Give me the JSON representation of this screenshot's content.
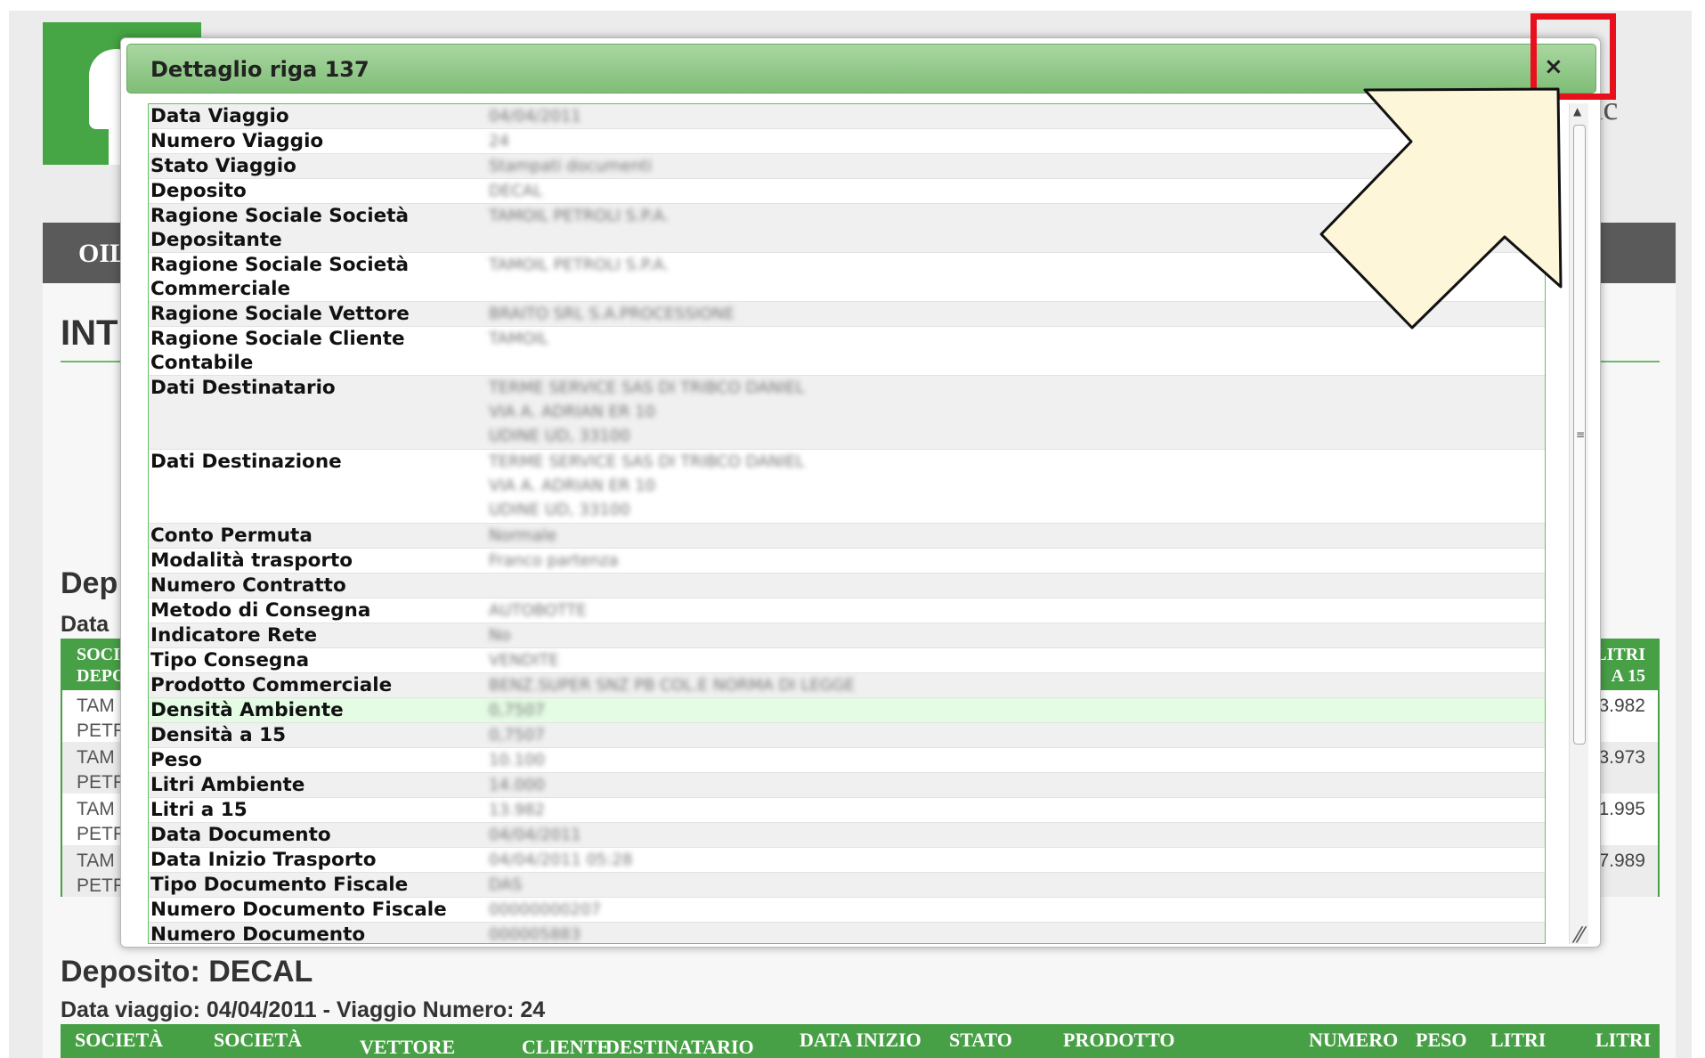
{
  "background": {
    "brand_suffix": "ic",
    "nav_label": "OIL",
    "main_title": "INT",
    "deposit_1": {
      "heading": "Dep",
      "sub": "Data",
      "table_head_left": [
        "SOCI",
        "DEPO"
      ],
      "table_head_right": [
        "LITRI",
        "A 15"
      ],
      "rows": [
        {
          "left": [
            "TAM",
            "PETR"
          ],
          "right": "3.982"
        },
        {
          "left": [
            "TAM",
            "PETR"
          ],
          "right": "3.973"
        },
        {
          "left": [
            "TAM",
            "PETR"
          ],
          "right": "1.995"
        },
        {
          "left": [
            "TAM",
            "PETR"
          ],
          "right": "7.989"
        }
      ]
    },
    "deposit_2": {
      "heading": "Deposito: DECAL",
      "sub": "Data viaggio: 04/04/2011 - Viaggio Numero: 24",
      "columns": [
        "SOCIETÀ",
        "SOCIETÀ",
        "VETTORE",
        "CLIENTE",
        "DESTINATARIO",
        "DATA INIZIO",
        "STATO",
        "PRODOTTO",
        "NUMERO",
        "PESO",
        "LITRI",
        "LITRI"
      ]
    }
  },
  "modal": {
    "title": "Dettaglio riga 137",
    "close_symbol": "×",
    "rows": [
      {
        "label": "Data Viaggio",
        "value": [
          "04/04/2011"
        ]
      },
      {
        "label": "Numero Viaggio",
        "value": [
          "24"
        ]
      },
      {
        "label": "Stato Viaggio",
        "value": [
          "Stampati documenti"
        ]
      },
      {
        "label": "Deposito",
        "value": [
          "DECAL"
        ]
      },
      {
        "label": "Ragione Sociale Società Depositante",
        "value": [
          "TAMOIL PETROLI S.P.A."
        ]
      },
      {
        "label": "Ragione Sociale Società Commerciale",
        "value": [
          "TAMOIL PETROLI S.P.A."
        ]
      },
      {
        "label": "Ragione Sociale Vettore",
        "value": [
          "BRAITO SRL S.A.PROCESSIONE"
        ]
      },
      {
        "label": "Ragione Sociale Cliente Contabile",
        "value": [
          "TAMOIL"
        ]
      },
      {
        "label": "Dati Destinatario",
        "value": [
          "TERME SERVICE SAS DI TRIBCO DANIEL",
          "VIA A. ADRIAN ER 10",
          "UDINE UD, 33100"
        ]
      },
      {
        "label": "Dati Destinazione",
        "value": [
          "TERME SERVICE SAS DI TRIBCO DANIEL",
          "VIA A. ADRIAN ER 10",
          "UDINE UD, 33100"
        ]
      },
      {
        "label": "Conto Permuta",
        "value": [
          "Normale"
        ]
      },
      {
        "label": "Modalità trasporto",
        "value": [
          "Franco partenza"
        ]
      },
      {
        "label": "Numero Contratto",
        "value": [
          ""
        ]
      },
      {
        "label": "Metodo di Consegna",
        "value": [
          "AUTOBOTTE"
        ]
      },
      {
        "label": "Indicatore Rete",
        "value": [
          "No"
        ]
      },
      {
        "label": "Tipo Consegna",
        "value": [
          "VENDITE"
        ]
      },
      {
        "label": "Prodotto Commerciale",
        "value": [
          "BENZ.SUPER SNZ PB COL.E NORMA DI LEGGE"
        ]
      },
      {
        "label": "Densità Ambiente",
        "value": [
          "0,7507"
        ]
      },
      {
        "label": "Densità a 15",
        "value": [
          "0,7507"
        ]
      },
      {
        "label": "Peso",
        "value": [
          "10.100"
        ]
      },
      {
        "label": "Litri Ambiente",
        "value": [
          "14.000"
        ]
      },
      {
        "label": "Litri a 15",
        "value": [
          "13.982"
        ]
      },
      {
        "label": "Data Documento",
        "value": [
          "04/04/2011"
        ]
      },
      {
        "label": "Data Inizio Trasporto",
        "value": [
          "04/04/2011 05:28"
        ]
      },
      {
        "label": "Tipo Documento Fiscale",
        "value": [
          "DAS"
        ]
      },
      {
        "label": "Numero Documento Fiscale",
        "value": [
          "00000000207"
        ]
      },
      {
        "label": "Numero Documento Commerciale",
        "value": [
          "000005883"
        ]
      }
    ]
  },
  "colors": {
    "accent_green": "#48a046",
    "titlebar_green": "#8cc885",
    "highlight_red": "#e8101c",
    "pointer_fill": "#fef6d8"
  }
}
